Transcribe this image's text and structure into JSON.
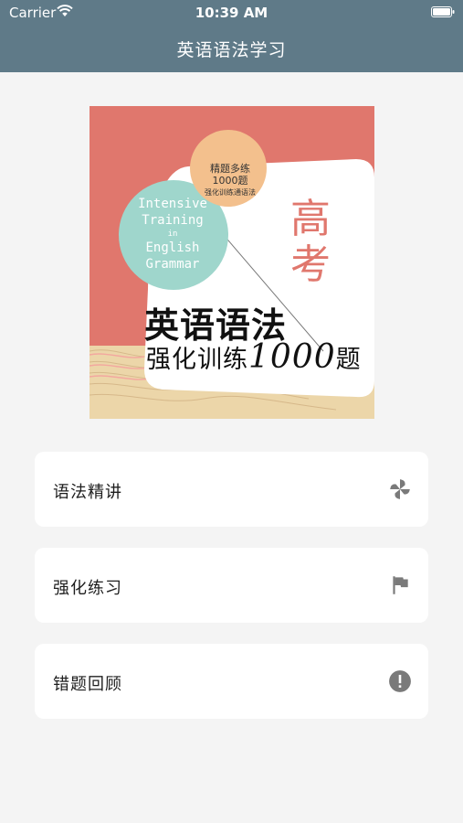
{
  "status_bar": {
    "carrier": "Carrier",
    "time": "10:39 AM"
  },
  "nav": {
    "title": "英语语法学习"
  },
  "cover": {
    "badge_line1": "精题多练",
    "badge_line2": "1000题",
    "badge_line3": "强化训练通语法",
    "english_line1": "Intensive",
    "english_line2": "Training",
    "english_line3": "in",
    "english_line4": "English",
    "english_line5": "Grammar",
    "gaokao": "高考",
    "title_main": "英语语法",
    "title_sub_a": "强化训练",
    "title_sub_num": "1000",
    "title_sub_b": "题",
    "colors": {
      "coral": "#e0776d",
      "mint": "#9fd6cc",
      "orange": "#f3c08d",
      "sand": "#ecd6a9"
    }
  },
  "menu": [
    {
      "label": "语法精讲",
      "icon": "pinwheel-icon"
    },
    {
      "label": "强化练习",
      "icon": "flag-icon"
    },
    {
      "label": "错题回顾",
      "icon": "alert-icon"
    }
  ],
  "theme": {
    "header": "#5f7a88",
    "background": "#f4f4f4",
    "icon_gray": "#7a7a7a"
  }
}
